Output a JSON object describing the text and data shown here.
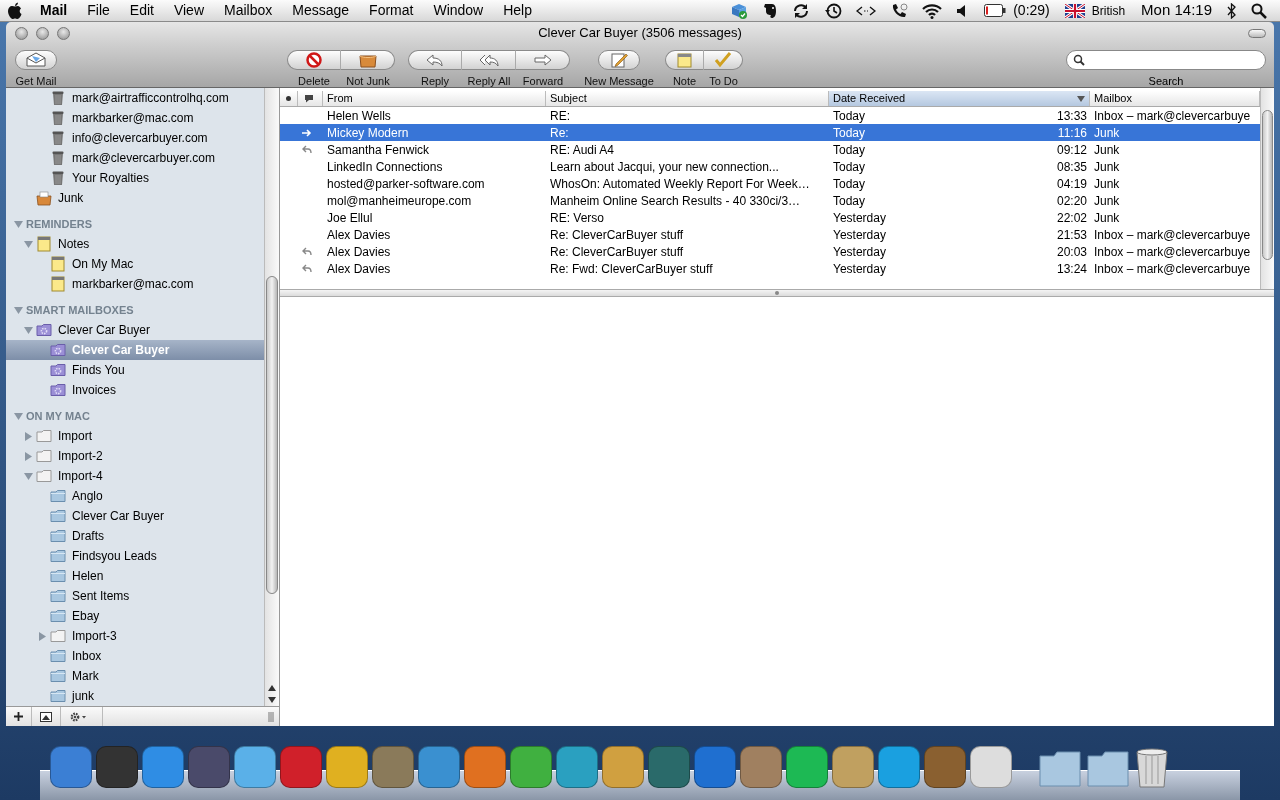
{
  "menubar": {
    "app": "Mail",
    "menus": [
      "File",
      "Edit",
      "View",
      "Mailbox",
      "Message",
      "Format",
      "Window",
      "Help"
    ],
    "battery_time": "(0:29)",
    "input_source": "British",
    "clock": "Mon 14:19"
  },
  "window": {
    "title": "Clever Car Buyer (3506 messages)"
  },
  "toolbar": {
    "groups": [
      {
        "items": [
          {
            "label": "Get Mail",
            "kind": "envelope"
          }
        ]
      },
      {
        "items": [
          {
            "label": "Delete",
            "kind": "no-entry"
          },
          {
            "label": "Not Junk",
            "kind": "bag"
          }
        ]
      },
      {
        "items": [
          {
            "label": "Reply",
            "kind": "reply"
          },
          {
            "label": "Reply All",
            "kind": "reply-all"
          },
          {
            "label": "Forward",
            "kind": "forward"
          }
        ]
      },
      {
        "items": [
          {
            "label": "New Message",
            "kind": "compose"
          }
        ]
      },
      {
        "items": [
          {
            "label": "Note",
            "kind": "note"
          },
          {
            "label": "To Do",
            "kind": "check"
          }
        ]
      }
    ],
    "search": {
      "label": "Search"
    }
  },
  "sidebar": {
    "sections": [
      {
        "continued_items": [
          {
            "label": "mark@airtrafficcontrolhq.com",
            "kind": "trash",
            "selected": false
          },
          {
            "label": "markbarker@mac.com",
            "kind": "trash",
            "selected": false
          },
          {
            "label": "info@clevercarbuyer.com",
            "kind": "trash",
            "selected": false
          },
          {
            "label": "mark@clevercarbuyer.com",
            "kind": "trash",
            "selected": false
          },
          {
            "label": "Your Royalties",
            "kind": "trash",
            "selected": false
          }
        ],
        "items": [
          {
            "label": "Junk",
            "kind": "junk",
            "selected": false
          }
        ]
      },
      {
        "title": "REMINDERS",
        "expanded": true,
        "items": [
          {
            "label": "Notes",
            "kind": "note",
            "selected": false,
            "expanded": true,
            "children": [
              {
                "label": "On My Mac",
                "kind": "note",
                "selected": false
              },
              {
                "label": "markbarker@mac.com",
                "kind": "note",
                "selected": false
              }
            ]
          }
        ]
      },
      {
        "title": "SMART MAILBOXES",
        "expanded": true,
        "items": [
          {
            "label": "Clever Car Buyer",
            "kind": "smart",
            "selected": false,
            "expanded": true,
            "children": [
              {
                "label": "Clever Car Buyer",
                "kind": "smart",
                "selected": true
              },
              {
                "label": "Finds You",
                "kind": "smart",
                "selected": false
              },
              {
                "label": "Invoices",
                "kind": "smart",
                "selected": false
              }
            ]
          }
        ]
      },
      {
        "title": "ON MY MAC",
        "expanded": true,
        "items": [
          {
            "label": "Import",
            "kind": "folder",
            "selected": false,
            "expanded": false
          },
          {
            "label": "Import-2",
            "kind": "folder",
            "selected": false,
            "expanded": false
          },
          {
            "label": "Import-4",
            "kind": "folder",
            "selected": false,
            "expanded": true,
            "children": [
              {
                "label": "Anglo",
                "kind": "mailfolder",
                "selected": false
              },
              {
                "label": "Clever Car Buyer",
                "kind": "mailfolder",
                "selected": false
              },
              {
                "label": "Drafts",
                "kind": "mailfolder",
                "selected": false
              },
              {
                "label": "Findsyou Leads",
                "kind": "mailfolder",
                "selected": false
              },
              {
                "label": "Helen",
                "kind": "mailfolder",
                "selected": false
              },
              {
                "label": "Sent Items",
                "kind": "mailfolder",
                "selected": false
              },
              {
                "label": "Ebay",
                "kind": "mailfolder",
                "selected": false
              },
              {
                "label": "Import-3",
                "kind": "folder",
                "selected": false,
                "expanded": false
              },
              {
                "label": "Inbox",
                "kind": "mailfolder",
                "selected": false
              },
              {
                "label": "Mark",
                "kind": "mailfolder",
                "selected": false
              },
              {
                "label": "junk",
                "kind": "mailfolder",
                "selected": false
              }
            ]
          }
        ]
      }
    ]
  },
  "messages": {
    "columns": [
      {
        "kind": "unread"
      },
      {
        "kind": "status"
      },
      {
        "kind": "text",
        "label": "From",
        "sorted": false
      },
      {
        "kind": "text",
        "label": "Subject",
        "sorted": false
      },
      {
        "kind": "text",
        "label": "Date Received",
        "sorted": true
      },
      {
        "kind": "text",
        "label": "Mailbox",
        "sorted": false
      }
    ],
    "rows": [
      {
        "replied": false,
        "forwarded": false,
        "from": "Helen Wells",
        "subject": "RE:",
        "date": "Today",
        "time": "13:33",
        "mailbox": "Inbox – mark@clevercarbuye",
        "selected": false
      },
      {
        "replied": false,
        "forwarded": true,
        "from": "Mickey Modern",
        "subject": "Re:",
        "date": "Today",
        "time": "11:16",
        "mailbox": "Junk",
        "selected": true
      },
      {
        "replied": true,
        "forwarded": false,
        "from": "Samantha Fenwick",
        "subject": "RE: Audi A4",
        "date": "Today",
        "time": "09:12",
        "mailbox": "Junk",
        "selected": false
      },
      {
        "replied": false,
        "forwarded": false,
        "from": "LinkedIn Connections",
        "subject": "Learn about Jacqui, your new connection...",
        "date": "Today",
        "time": "08:35",
        "mailbox": "Junk",
        "selected": false
      },
      {
        "replied": false,
        "forwarded": false,
        "from": "hosted@parker-software.com",
        "subject": "WhosOn: Automated Weekly Report For Week…",
        "date": "Today",
        "time": "04:19",
        "mailbox": "Junk",
        "selected": false
      },
      {
        "replied": false,
        "forwarded": false,
        "from": "mol@manheimeurope.com",
        "subject": "Manheim Online Search Results - 40 330ci/3…",
        "date": "Today",
        "time": "02:20",
        "mailbox": "Junk",
        "selected": false
      },
      {
        "replied": false,
        "forwarded": false,
        "from": "Joe Ellul",
        "subject": "RE: Verso",
        "date": "Yesterday",
        "time": "22:02",
        "mailbox": "Junk",
        "selected": false
      },
      {
        "replied": false,
        "forwarded": false,
        "from": "Alex Davies",
        "subject": "Re: CleverCarBuyer stuff",
        "date": "Yesterday",
        "time": "21:53",
        "mailbox": "Inbox – mark@clevercarbuye",
        "selected": false
      },
      {
        "replied": true,
        "forwarded": false,
        "from": "Alex Davies",
        "subject": "Re: CleverCarBuyer stuff",
        "date": "Yesterday",
        "time": "20:03",
        "mailbox": "Inbox – mark@clevercarbuye",
        "selected": false
      },
      {
        "replied": true,
        "forwarded": false,
        "from": "Alex Davies",
        "subject": "Re: Fwd: CleverCarBuyer stuff",
        "date": "Yesterday",
        "time": "13:24",
        "mailbox": "Inbox – mark@clevercarbuye",
        "selected": false
      }
    ]
  },
  "dock": {
    "apps": [
      {
        "color": "#3b7fd4"
      },
      {
        "color": "#333333"
      },
      {
        "color": "#2f8de4"
      },
      {
        "color": "#4a4a6a"
      },
      {
        "color": "#5ab0e8"
      },
      {
        "color": "#d0202a"
      },
      {
        "color": "#e0b020"
      },
      {
        "color": "#8a7a5a"
      },
      {
        "color": "#3a90d0"
      },
      {
        "color": "#e07020"
      },
      {
        "color": "#40b040"
      },
      {
        "color": "#2aa0c0"
      },
      {
        "color": "#d0a040"
      },
      {
        "color": "#2a6a6a"
      },
      {
        "color": "#1f6fd0"
      },
      {
        "color": "#a08060"
      },
      {
        "color": "#1db954"
      },
      {
        "color": "#c0a060"
      },
      {
        "color": "#1aa0e0"
      },
      {
        "color": "#8a6030"
      },
      {
        "color": "#dddddd"
      }
    ],
    "stacks": [
      {
        "kind": "folder"
      },
      {
        "kind": "folder"
      },
      {
        "kind": "trash"
      }
    ]
  }
}
